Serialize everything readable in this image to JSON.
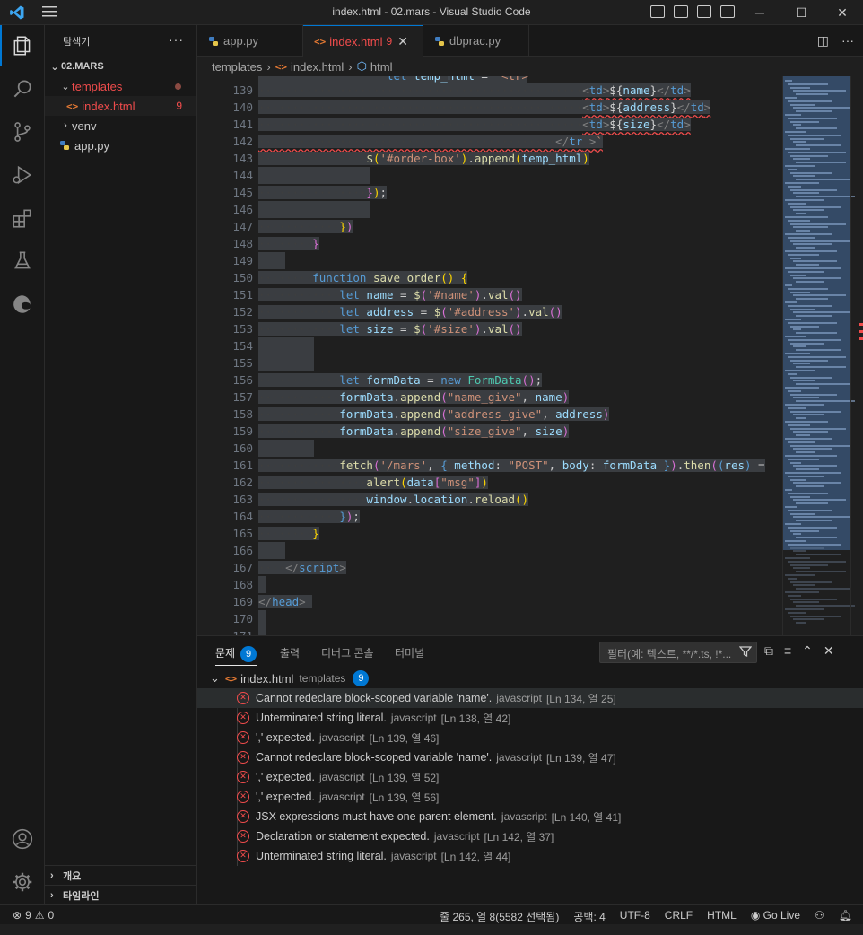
{
  "window": {
    "title": "index.html - 02.mars - Visual Studio Code"
  },
  "activity": [
    "explorer-icon",
    "search-icon",
    "source-control-icon",
    "run-debug-icon",
    "extensions-icon",
    "testing-icon",
    "edge-icon",
    "account-icon",
    "settings-icon"
  ],
  "sidebar": {
    "header": "탐색기",
    "project": "02.MARS",
    "items": [
      {
        "label": "templates",
        "type": "folder"
      },
      {
        "label": "index.html",
        "type": "file",
        "count": "9"
      },
      {
        "label": "venv",
        "type": "folder"
      },
      {
        "label": "app.py",
        "type": "file"
      }
    ],
    "bottom": [
      "개요",
      "타임라인"
    ]
  },
  "tabs": [
    {
      "label": "app.py"
    },
    {
      "label": "index.html",
      "badge": "9"
    },
    {
      "label": "dbprac.py"
    }
  ],
  "breadcrumb": [
    "templates",
    "index.html",
    "html"
  ],
  "editor": {
    "line_numbers": [
      "139",
      "140",
      "141",
      "142",
      "143",
      "144",
      "145",
      "146",
      "147",
      "148",
      "149",
      "150",
      "151",
      "152",
      "153",
      "154",
      "155",
      "156",
      "157",
      "158",
      "159",
      "160",
      "161",
      "162",
      "163",
      "164",
      "165",
      "166",
      "167",
      "168",
      "169",
      "170",
      "171"
    ]
  },
  "panel": {
    "tabs": [
      "문제",
      "출력",
      "디버그 콘솔",
      "터미널"
    ],
    "problem_count": "9",
    "filter_placeholder": "필터(예: 텍스트, **/*.ts, !*...",
    "group": {
      "file": "index.html",
      "dir": "templates",
      "count": "9"
    },
    "problems": [
      {
        "msg": "Cannot redeclare block-scoped variable 'name'.",
        "src": "javascript",
        "loc": "[Ln 134, 열 25]"
      },
      {
        "msg": "Unterminated string literal.",
        "src": "javascript",
        "loc": "[Ln 138, 열 42]"
      },
      {
        "msg": "',' expected.",
        "src": "javascript",
        "loc": "[Ln 139, 열 46]"
      },
      {
        "msg": "Cannot redeclare block-scoped variable 'name'.",
        "src": "javascript",
        "loc": "[Ln 139, 열 47]"
      },
      {
        "msg": "',' expected.",
        "src": "javascript",
        "loc": "[Ln 139, 열 52]"
      },
      {
        "msg": "',' expected.",
        "src": "javascript",
        "loc": "[Ln 139, 열 56]"
      },
      {
        "msg": "JSX expressions must have one parent element.",
        "src": "javascript",
        "loc": "[Ln 140, 열 41]"
      },
      {
        "msg": "Declaration or statement expected.",
        "src": "javascript",
        "loc": "[Ln 142, 열 37]"
      },
      {
        "msg": "Unterminated string literal.",
        "src": "javascript",
        "loc": "[Ln 142, 열 44]"
      }
    ]
  },
  "status": {
    "errors": "9",
    "warnings": "0",
    "position": "줄 265, 열 8(5582 선택됨)",
    "spaces": "공백: 4",
    "encoding": "UTF-8",
    "eol": "CRLF",
    "language": "HTML",
    "golive": "Go Live"
  }
}
